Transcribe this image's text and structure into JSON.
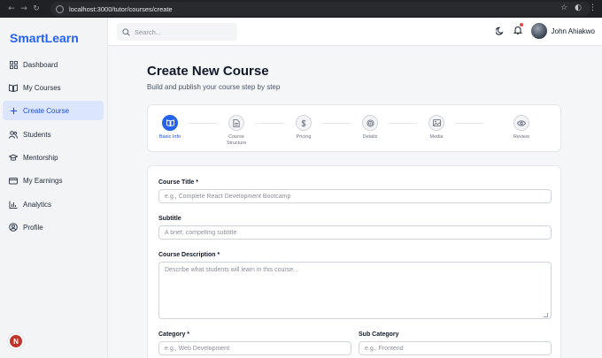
{
  "browser": {
    "url": "localhost:3000/tutor/courses/create"
  },
  "sidebar": {
    "brand": "SmartLearn",
    "items": [
      {
        "label": "Dashboard"
      },
      {
        "label": "My Courses"
      },
      {
        "label": "Create Course"
      },
      {
        "label": "Students"
      },
      {
        "label": "Mentorship"
      },
      {
        "label": "My Earnings"
      },
      {
        "label": "Analytics"
      },
      {
        "label": "Profile"
      }
    ],
    "active_index": 2,
    "avatar_letter": "N"
  },
  "topbar": {
    "search_placeholder": "Search...",
    "user_name": "John Ahiakwo"
  },
  "main": {
    "title": "Create New Course",
    "subtitle": "Build and publish your course step by step",
    "steps": [
      {
        "label": "Basic Info",
        "icon": "book-icon"
      },
      {
        "label": "Course Structure",
        "icon": "document-icon"
      },
      {
        "label": "Pricing",
        "icon": "dollar-icon"
      },
      {
        "label": "Details",
        "icon": "target-icon"
      },
      {
        "label": "Media",
        "icon": "image-icon"
      },
      {
        "label": "Review",
        "icon": "eye-icon"
      }
    ],
    "active_step": 0,
    "form": {
      "title_label": "Course Title *",
      "title_placeholder": "e.g., Complete React Development Bootcamp",
      "subtitle_label": "Subtitle",
      "subtitle_placeholder": "A brief, compelling subtitle",
      "description_label": "Course Description *",
      "description_placeholder": "Describe what students will learn in this course...",
      "category_label": "Category *",
      "category_placeholder": "e.g., Web Development",
      "subcategory_label": "Sub Category",
      "subcategory_placeholder": "e.g., Frontend"
    }
  },
  "colors": {
    "accent": "#2563eb",
    "active_bg": "#dbe5fb",
    "notification": "#ef4444"
  }
}
